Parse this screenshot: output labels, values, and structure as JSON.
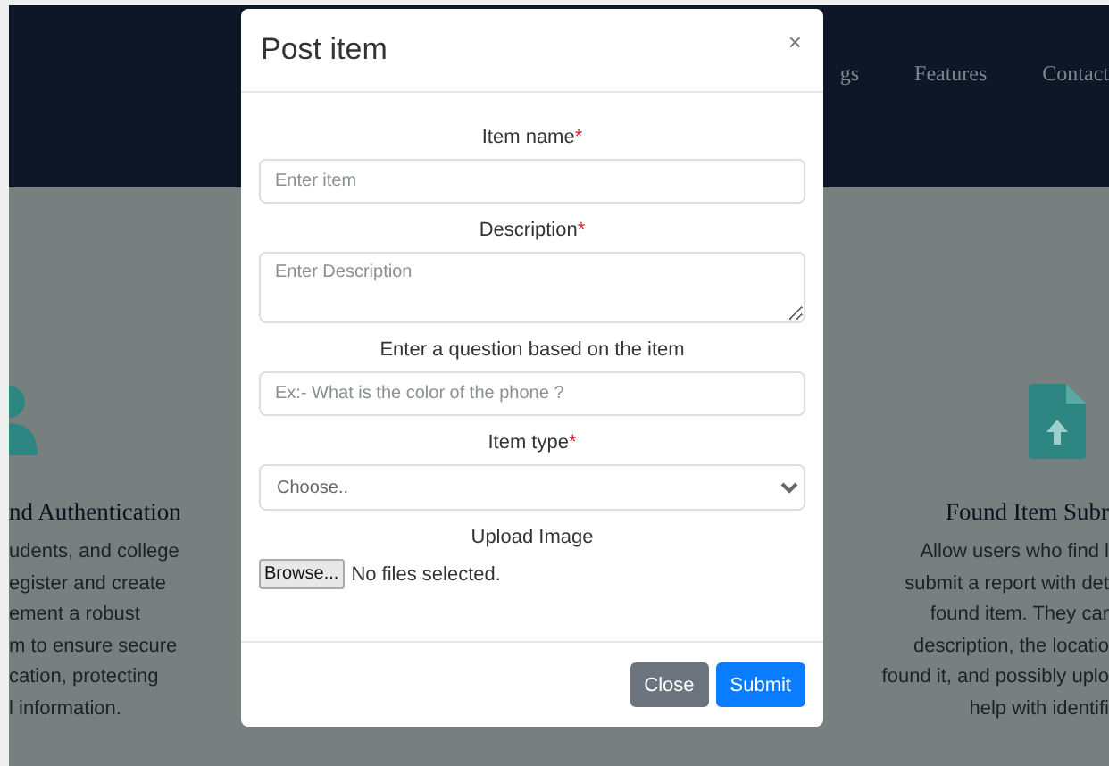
{
  "nav": {
    "links": [
      "gs",
      "Features",
      "Contact"
    ]
  },
  "features": [
    {
      "kind": "person",
      "title": "nd Authentication",
      "lines": [
        "udents, and college",
        "egister and create",
        "ement a robust",
        "m to ensure secure",
        "cation, protecting",
        "l information."
      ]
    },
    {
      "kind": "file-upload",
      "title": "Found Item Subr",
      "lines": [
        "Allow users who find l",
        "submit a report with det",
        "found item. They car",
        "description, the locatio",
        "found it, and possibly uplo",
        "help with identifi"
      ]
    }
  ],
  "modal": {
    "title": "Post item",
    "close_glyph": "×",
    "fields": [
      {
        "kind": "text",
        "label": "Item name",
        "required_mark": "*",
        "placeholder": "Enter item"
      },
      {
        "kind": "textarea",
        "label": "Description",
        "required_mark": "*",
        "placeholder": "Enter Description"
      },
      {
        "kind": "text",
        "label": "Enter a question based on the item",
        "placeholder": "Ex:- What is the color of the phone ?"
      },
      {
        "kind": "select",
        "label": "Item type",
        "required_mark": "*",
        "value": "Choose.."
      },
      {
        "kind": "file",
        "label": "Upload Image",
        "button": "Browse...",
        "status": "No files selected."
      }
    ],
    "buttons": [
      {
        "label": "Close",
        "kind": "secondary"
      },
      {
        "label": "Submit",
        "kind": "primary"
      }
    ]
  }
}
